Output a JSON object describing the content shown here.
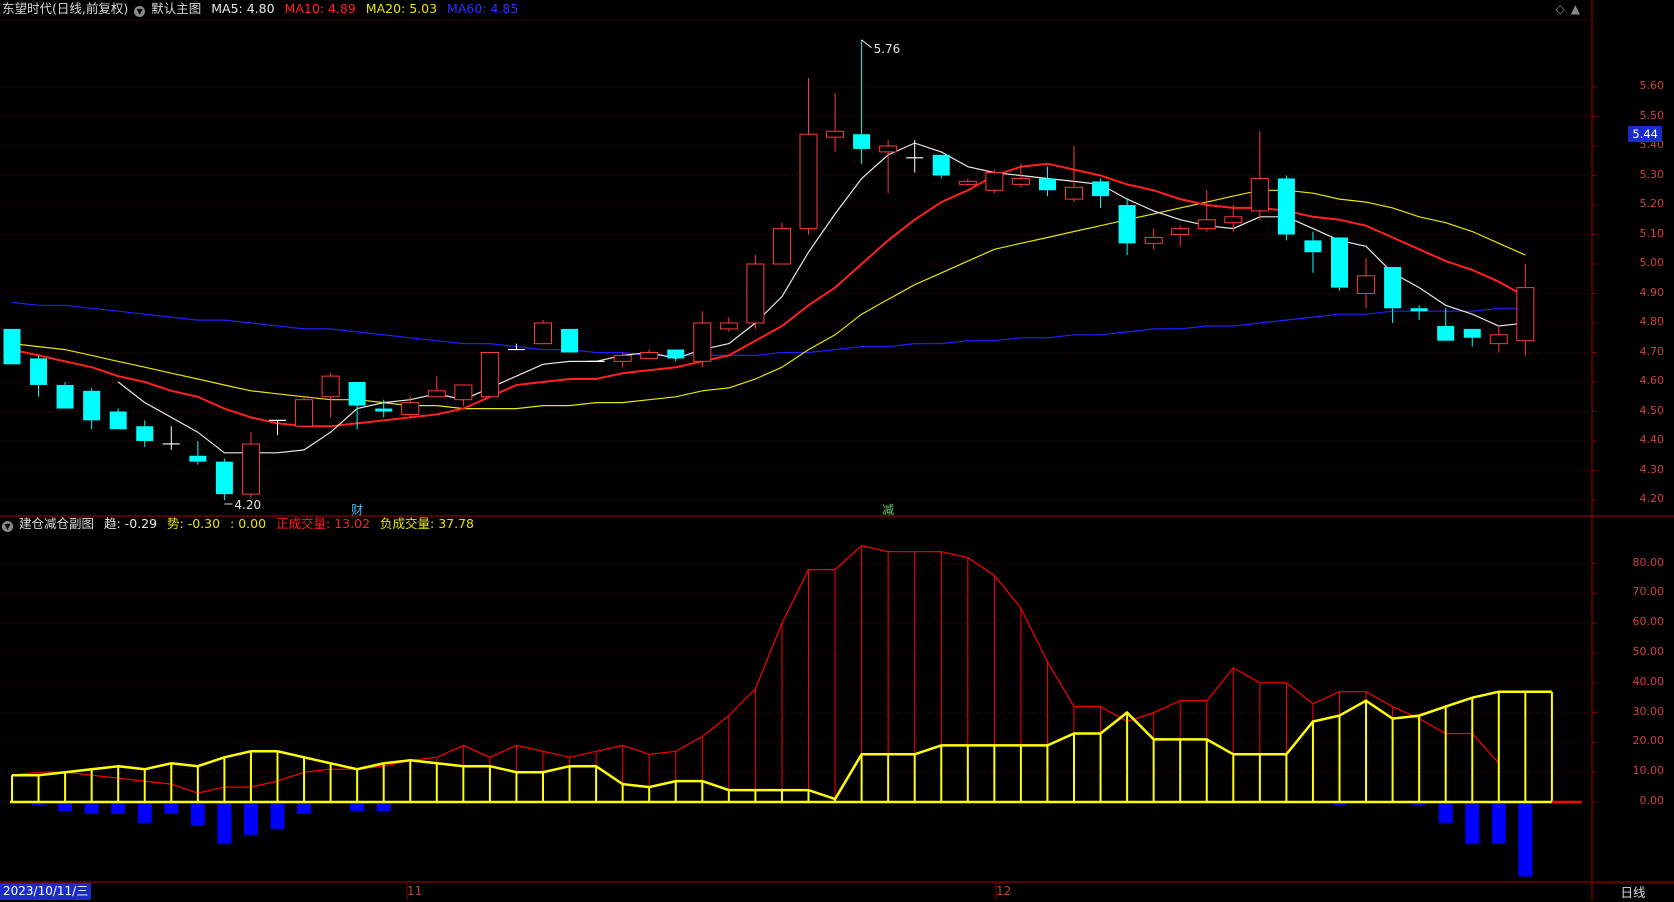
{
  "main_header": {
    "symbol": "东望时代(日线,前复权)",
    "chart_name": "默认主图",
    "ma5": "MA5: 4.80",
    "ma10": "MA10: 4.89",
    "ma20": "MA20: 5.03",
    "ma60": "MA60: 4.85"
  },
  "sub_header": {
    "indicator_name": "建仓减仓副图",
    "trend": "趋: -0.29",
    "momentum": "势: -0.30",
    "blank_value": ": 0.00",
    "positive_volume": "正成交量: 13.02",
    "negative_volume": "负成交量: 37.78"
  },
  "price_axis": [
    "5.60",
    "5.50",
    "5.40",
    "5.30",
    "5.20",
    "5.10",
    "5.00",
    "4.90",
    "4.80",
    "4.70",
    "4.60",
    "4.50",
    "4.40",
    "4.30",
    "4.20"
  ],
  "current_price": "5.44",
  "indicator_axis": [
    "80.00",
    "70.00",
    "60.00",
    "50.00",
    "40.00",
    "30.00",
    "20.00",
    "10.00",
    "0.00"
  ],
  "annotations": {
    "high_label": "5.76",
    "low_label": "4.20",
    "event_cai": "财",
    "event_jian": "减"
  },
  "x_axis": {
    "start_date": "2023/10/11/三",
    "month_11": "11",
    "month_12": "12"
  },
  "period_label": "日线",
  "colors": {
    "up": "#ff3a3a",
    "down": "#00ffff",
    "ma5": "#e8e8e8",
    "ma10": "#ff2020",
    "ma20": "#e6e600",
    "ma60": "#2020ff",
    "indicator_red": "#ff0000",
    "indicator_yellow": "#ffff00",
    "indicator_blue": "#0000ff"
  },
  "candles": [
    [
      4.78,
      4.78,
      4.66,
      4.66
    ],
    [
      4.68,
      4.69,
      4.55,
      4.59
    ],
    [
      4.59,
      4.6,
      4.51,
      4.51
    ],
    [
      4.57,
      4.58,
      4.44,
      4.47
    ],
    [
      4.5,
      4.51,
      4.44,
      4.44
    ],
    [
      4.45,
      4.47,
      4.38,
      4.4
    ],
    [
      4.39,
      4.45,
      4.37,
      4.39
    ],
    [
      4.35,
      4.4,
      4.32,
      4.33
    ],
    [
      4.33,
      4.34,
      4.2,
      4.22
    ],
    [
      4.22,
      4.43,
      4.21,
      4.39
    ],
    [
      4.47,
      4.47,
      4.42,
      4.47
    ],
    [
      4.45,
      4.55,
      4.45,
      4.54
    ],
    [
      4.55,
      4.63,
      4.48,
      4.62
    ],
    [
      4.6,
      4.6,
      4.44,
      4.52
    ],
    [
      4.51,
      4.54,
      4.48,
      4.5
    ],
    [
      4.49,
      4.55,
      4.48,
      4.53
    ],
    [
      4.55,
      4.62,
      4.55,
      4.57
    ],
    [
      4.54,
      4.59,
      4.52,
      4.59
    ],
    [
      4.55,
      4.7,
      4.55,
      4.7
    ],
    [
      4.71,
      4.73,
      4.71,
      4.71
    ],
    [
      4.73,
      4.81,
      4.73,
      4.8
    ],
    [
      4.78,
      4.78,
      4.7,
      4.7
    ],
    [
      4.67,
      4.67,
      4.67,
      4.67
    ],
    [
      4.67,
      4.7,
      4.65,
      4.69
    ],
    [
      4.68,
      4.71,
      4.68,
      4.7
    ],
    [
      4.71,
      4.71,
      4.67,
      4.68
    ],
    [
      4.67,
      4.84,
      4.65,
      4.8
    ],
    [
      4.78,
      4.82,
      4.77,
      4.8
    ],
    [
      4.8,
      5.03,
      4.78,
      5.0
    ],
    [
      5.0,
      5.14,
      5.0,
      5.12
    ],
    [
      5.12,
      5.63,
      5.1,
      5.44
    ],
    [
      5.43,
      5.58,
      5.38,
      5.45
    ],
    [
      5.44,
      5.76,
      5.34,
      5.39
    ],
    [
      5.38,
      5.42,
      5.24,
      5.4
    ],
    [
      5.36,
      5.42,
      5.31,
      5.36
    ],
    [
      5.37,
      5.37,
      5.29,
      5.3
    ],
    [
      5.27,
      5.29,
      5.27,
      5.28
    ],
    [
      5.25,
      5.32,
      5.24,
      5.31
    ],
    [
      5.27,
      5.34,
      5.26,
      5.29
    ],
    [
      5.29,
      5.33,
      5.23,
      5.25
    ],
    [
      5.22,
      5.4,
      5.21,
      5.26
    ],
    [
      5.28,
      5.29,
      5.19,
      5.23
    ],
    [
      5.2,
      5.22,
      5.03,
      5.07
    ],
    [
      5.07,
      5.12,
      5.05,
      5.09
    ],
    [
      5.1,
      5.13,
      5.06,
      5.12
    ],
    [
      5.12,
      5.25,
      5.11,
      5.15
    ],
    [
      5.14,
      5.2,
      5.11,
      5.16
    ],
    [
      5.18,
      5.45,
      5.15,
      5.29
    ],
    [
      5.29,
      5.3,
      5.08,
      5.1
    ],
    [
      5.08,
      5.11,
      4.97,
      5.04
    ],
    [
      5.09,
      5.09,
      4.91,
      4.92
    ],
    [
      4.9,
      5.02,
      4.85,
      4.96
    ],
    [
      4.99,
      4.99,
      4.8,
      4.85
    ],
    [
      4.85,
      4.86,
      4.81,
      4.84
    ],
    [
      4.79,
      4.85,
      4.74,
      4.74
    ],
    [
      4.78,
      4.78,
      4.72,
      4.75
    ],
    [
      4.73,
      4.79,
      4.7,
      4.76
    ],
    [
      4.74,
      5.0,
      4.69,
      4.92
    ]
  ],
  "ma5_values": [
    null,
    null,
    null,
    null,
    4.6,
    4.53,
    4.48,
    4.43,
    4.36,
    4.36,
    4.36,
    4.37,
    4.43,
    4.51,
    4.53,
    4.54,
    4.56,
    4.54,
    4.58,
    4.62,
    4.66,
    4.67,
    4.67,
    4.69,
    4.7,
    4.68,
    4.71,
    4.73,
    4.8,
    4.89,
    5.04,
    5.17,
    5.29,
    5.37,
    5.41,
    5.38,
    5.33,
    5.31,
    5.3,
    5.29,
    5.28,
    5.27,
    5.22,
    5.18,
    5.15,
    5.13,
    5.12,
    5.16,
    5.16,
    5.12,
    5.08,
    5.06,
    4.97,
    4.92,
    4.86,
    4.83,
    4.79,
    4.8
  ],
  "ma10_values": [
    4.71,
    4.69,
    4.67,
    4.65,
    4.62,
    4.6,
    4.57,
    4.55,
    4.51,
    4.48,
    4.46,
    4.45,
    4.45,
    4.46,
    4.47,
    4.48,
    4.49,
    4.51,
    4.55,
    4.59,
    4.6,
    4.61,
    4.61,
    4.63,
    4.64,
    4.65,
    4.67,
    4.69,
    4.74,
    4.79,
    4.86,
    4.92,
    5.0,
    5.08,
    5.15,
    5.21,
    5.25,
    5.3,
    5.33,
    5.34,
    5.32,
    5.3,
    5.27,
    5.25,
    5.22,
    5.2,
    5.19,
    5.19,
    5.18,
    5.16,
    5.15,
    5.13,
    5.09,
    5.05,
    5.01,
    4.98,
    4.94,
    4.89
  ],
  "ma20_values": [
    4.73,
    4.72,
    4.71,
    4.69,
    4.67,
    4.65,
    4.63,
    4.61,
    4.59,
    4.57,
    4.56,
    4.55,
    4.54,
    4.54,
    4.53,
    4.52,
    4.52,
    4.51,
    4.51,
    4.51,
    4.52,
    4.52,
    4.53,
    4.53,
    4.54,
    4.55,
    4.57,
    4.58,
    4.61,
    4.65,
    4.71,
    4.76,
    4.83,
    4.88,
    4.93,
    4.97,
    5.01,
    5.05,
    5.07,
    5.09,
    5.11,
    5.13,
    5.15,
    5.17,
    5.19,
    5.21,
    5.23,
    5.25,
    5.25,
    5.24,
    5.22,
    5.21,
    5.19,
    5.16,
    5.14,
    5.11,
    5.07,
    5.03
  ],
  "ma60_values": [
    4.87,
    4.86,
    4.86,
    4.85,
    4.84,
    4.83,
    4.82,
    4.81,
    4.81,
    4.8,
    4.79,
    4.78,
    4.78,
    4.77,
    4.76,
    4.75,
    4.74,
    4.73,
    4.73,
    4.72,
    4.71,
    4.71,
    4.7,
    4.7,
    4.69,
    4.69,
    4.69,
    4.69,
    4.69,
    4.7,
    4.7,
    4.71,
    4.72,
    4.72,
    4.73,
    4.73,
    4.74,
    4.74,
    4.75,
    4.75,
    4.76,
    4.76,
    4.77,
    4.78,
    4.78,
    4.79,
    4.79,
    4.8,
    4.81,
    4.82,
    4.83,
    4.83,
    4.84,
    4.84,
    4.84,
    4.84,
    4.85,
    4.85
  ],
  "indicator_red": [
    9,
    10,
    10,
    9,
    8,
    7,
    6,
    3,
    5,
    5,
    7,
    10,
    11,
    11,
    12,
    14,
    15,
    19,
    15,
    19,
    17,
    15,
    17,
    19,
    16,
    17,
    22,
    29,
    38,
    60,
    78,
    78,
    86,
    84,
    84,
    84,
    82,
    76,
    65,
    47,
    32,
    32,
    27,
    30,
    34,
    34,
    45,
    40,
    40,
    33,
    37,
    37,
    32,
    28,
    23,
    23,
    13
  ],
  "indicator_yellow": [
    9,
    9,
    10,
    11,
    12,
    11,
    13,
    12,
    15,
    17,
    17,
    15,
    13,
    11,
    13,
    14,
    13,
    12,
    12,
    10,
    10,
    12,
    12,
    6,
    5,
    7,
    7,
    4,
    4,
    4,
    4,
    1,
    16,
    16,
    16,
    19,
    19,
    19,
    19,
    19,
    23,
    23,
    30,
    21,
    21,
    21,
    16,
    16,
    16,
    27,
    29,
    34,
    28,
    29,
    32,
    35,
    37,
    37,
    37
  ],
  "indicator_blue": [
    0,
    -1,
    -3,
    -4,
    -4,
    -7,
    -4,
    -8,
    -14,
    -11,
    -9,
    -4,
    0,
    -3,
    -3,
    0,
    0,
    0,
    0,
    0,
    0,
    0,
    0,
    0,
    0,
    0,
    0,
    0,
    0,
    0,
    0,
    0,
    0,
    0,
    0,
    0,
    0,
    0,
    0,
    0,
    0,
    0,
    0,
    0,
    0,
    0,
    0,
    0,
    0,
    0,
    -1,
    0,
    0,
    -1,
    -7,
    -14,
    -14,
    -25
  ]
}
